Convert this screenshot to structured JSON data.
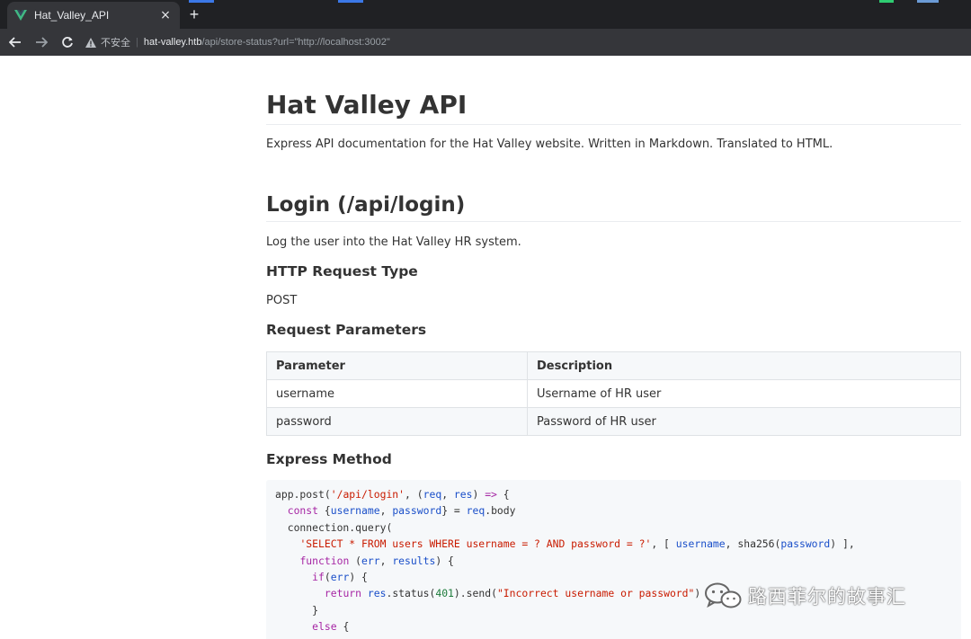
{
  "browser": {
    "tab_title": "Hat_Valley_API",
    "tab_close": "×",
    "new_tab": "+",
    "security_label": "不安全",
    "url_host": "hat-valley.htb",
    "url_path": "/api/store-status?url=\"http://localhost:3002\""
  },
  "page": {
    "title": "Hat Valley API",
    "intro": "Express API documentation for the Hat Valley website. Written in Markdown. Translated to HTML.",
    "login": {
      "heading": "Login (/api/login)",
      "description": "Log the user into the Hat Valley HR system.",
      "request_type_heading": "HTTP Request Type",
      "request_type": "POST",
      "params_heading": "Request Parameters",
      "table": {
        "headers": [
          "Parameter",
          "Description"
        ],
        "rows": [
          [
            "username",
            "Username of HR user"
          ],
          [
            "password",
            "Password of HR user"
          ]
        ]
      },
      "method_heading": "Express Method",
      "code": [
        "app.post('/api/login', (req, res) => {",
        "  const {username, password} = req.body",
        "  connection.query(",
        "    'SELECT * FROM users WHERE username = ? AND password = ?', [ username, sha256(password) ],",
        "    function (err, results) {",
        "      if(err) {",
        "        return res.status(401).send(\"Incorrect username or password\")",
        "      }",
        "      else {"
      ]
    }
  },
  "watermark": {
    "text": "路西菲尔的故事汇",
    "icon": "wechat-icon"
  }
}
